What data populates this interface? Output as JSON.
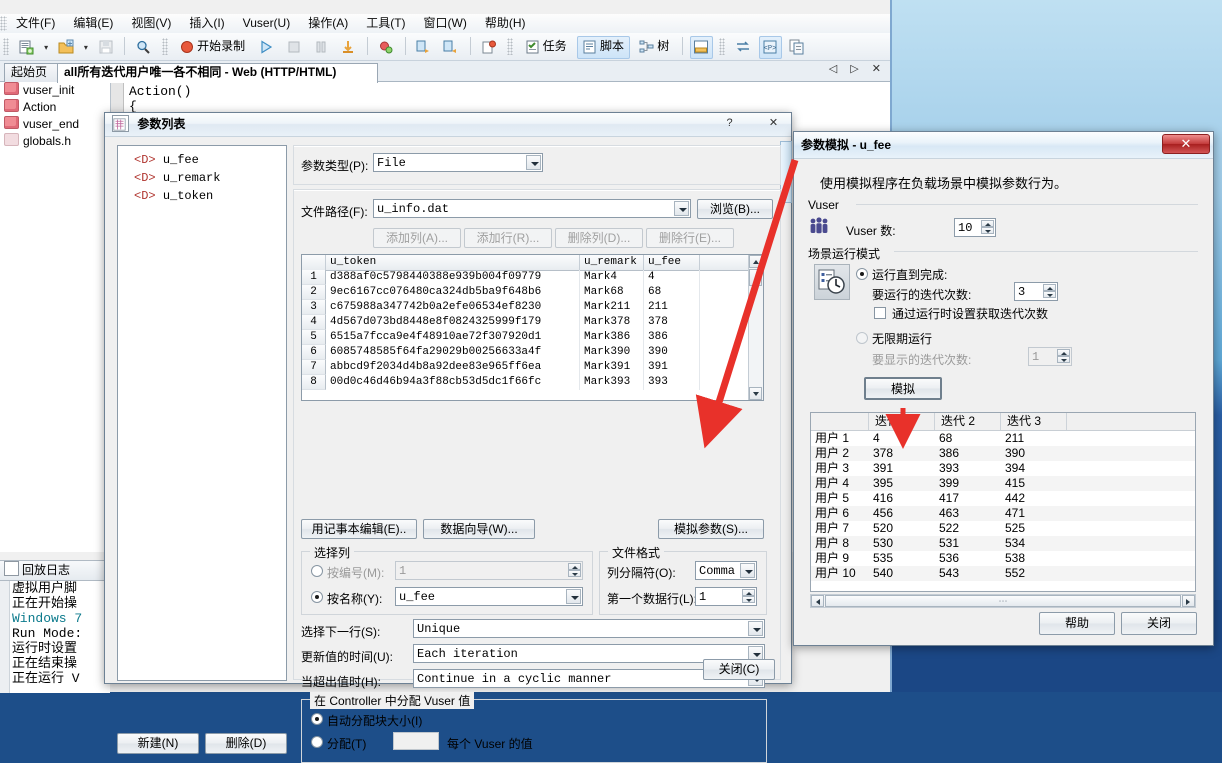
{
  "app": {
    "menubar": [
      "文件(F)",
      "编辑(E)",
      "视图(V)",
      "插入(I)",
      "Vuser(U)",
      "操作(A)",
      "工具(T)",
      "窗口(W)",
      "帮助(H)"
    ],
    "toolbar": {
      "record_label": "开始录制",
      "task_label": "任务",
      "script_label": "脚本",
      "tree_label": "树"
    },
    "tabs": [
      {
        "label": "起始页",
        "active": false
      },
      {
        "label": "all所有迭代用户唯一各不相同 - Web (HTTP/HTML)",
        "active": true
      }
    ],
    "tree_items": [
      {
        "label": "vuser_init",
        "icon": "action-icon"
      },
      {
        "label": "Action",
        "icon": "action-icon"
      },
      {
        "label": "vuser_end",
        "icon": "action-icon"
      },
      {
        "label": "globals.h",
        "icon": "header-icon"
      }
    ],
    "code_lines": [
      "Action()",
      "{"
    ],
    "log": {
      "tab_label": "回放日志",
      "lines": [
        "虚拟用户脚",
        "正在开始操",
        "Windows 7",
        "Run Mode:",
        "运行时设置",
        "正在结束操",
        "正在运行 V"
      ]
    }
  },
  "param_dialog": {
    "title": "参数列表",
    "help_btn": "?",
    "close_btn": "✕",
    "tree": [
      "u_fee",
      "u_remark",
      "u_token"
    ],
    "type_label": "参数类型(P):",
    "type_value": "File",
    "filepath_label": "文件路径(F):",
    "filepath_value": "u_info.dat",
    "browse_btn": "浏览(B)...",
    "row_buttons": [
      "添加列(A)...",
      "添加行(R)...",
      "删除列(D)...",
      "删除行(E)..."
    ],
    "table": {
      "columns": [
        "u_token",
        "u_remark",
        "u_fee"
      ],
      "rows": [
        {
          "n": "1",
          "u_token": "d388af0c5798440388e939b004f09779",
          "u_remark": "Mark4",
          "u_fee": "4"
        },
        {
          "n": "2",
          "u_token": "9ec6167cc076480ca324db5ba9f648b6",
          "u_remark": "Mark68",
          "u_fee": "68"
        },
        {
          "n": "3",
          "u_token": "c675988a347742b0a2efe06534ef8230",
          "u_remark": "Mark211",
          "u_fee": "211"
        },
        {
          "n": "4",
          "u_token": "4d567d073bd8448e8f0824325999f179",
          "u_remark": "Mark378",
          "u_fee": "378"
        },
        {
          "n": "5",
          "u_token": "6515a7fcca9e4f48910ae72f307920d1",
          "u_remark": "Mark386",
          "u_fee": "386"
        },
        {
          "n": "6",
          "u_token": "6085748585f64fa29029b00256633a4f",
          "u_remark": "Mark390",
          "u_fee": "390"
        },
        {
          "n": "7",
          "u_token": "abbcd9f2034d4b8a92dee83e965ff6ea",
          "u_remark": "Mark391",
          "u_fee": "391"
        },
        {
          "n": "8",
          "u_token": "00d0c46d46b94a3f88cb53d5dc1f66fc",
          "u_remark": "Mark393",
          "u_fee": "393"
        }
      ]
    },
    "notepad_btn": "用记事本编辑(E)..",
    "wizard_btn": "数据向导(W)...",
    "simulate_param_btn": "模拟参数(S)...",
    "select_col_group": "选择列",
    "by_number_label": "按编号(M):",
    "by_number_value": "1",
    "by_name_label": "按名称(Y):",
    "by_name_value": "u_fee",
    "file_format_group": "文件格式",
    "col_sep_label": "列分隔符(O):",
    "col_sep_value": "Comma",
    "first_row_label": "第一个数据行(L):",
    "first_row_value": "1",
    "next_row_label": "选择下一行(S):",
    "next_row_value": "Unique",
    "update_label": "更新值的时间(U):",
    "update_value": "Each iteration",
    "outofvalues_label": "当超出值时(H):",
    "outofvalues_value": "Continue in a cyclic manner",
    "alloc_group": "在 Controller 中分配 Vuser 值",
    "alloc_auto_label": "自动分配块大小(I)",
    "alloc_manual_label": "分配(T)",
    "alloc_manual_suffix": "每个 Vuser 的值",
    "alloc_manual_value": "",
    "new_btn": "新建(N)",
    "delete_btn": "删除(D)",
    "close_bottom_btn": "关闭(C)"
  },
  "sim_dialog": {
    "title": "参数模拟 - u_fee",
    "close_btn": "✕",
    "description": "使用模拟程序在负载场景中模拟参数行为。",
    "vuser_group": "Vuser",
    "vuser_count_label": "Vuser 数:",
    "vuser_count_value": "10",
    "runmode_group": "场景运行模式",
    "run_until_complete_label": "运行直到完成:",
    "iterations_label": "要运行的迭代次数:",
    "iterations_value": "3",
    "runtime_checkbox_label": "通过运行时设置获取迭代次数",
    "run_indefinitely_label": "无限期运行",
    "display_iterations_label": "要显示的迭代次数:",
    "display_iterations_value": "1",
    "simulate_btn": "模拟",
    "results": {
      "columns": [
        "",
        "迭代 1",
        "迭代 2",
        "迭代 3"
      ],
      "rows": [
        {
          "user": "用户 1",
          "v": [
            "4",
            "68",
            "211"
          ]
        },
        {
          "user": "用户 2",
          "v": [
            "378",
            "386",
            "390"
          ]
        },
        {
          "user": "用户 3",
          "v": [
            "391",
            "393",
            "394"
          ]
        },
        {
          "user": "用户 4",
          "v": [
            "395",
            "399",
            "415"
          ]
        },
        {
          "user": "用户 5",
          "v": [
            "416",
            "417",
            "442"
          ]
        },
        {
          "user": "用户 6",
          "v": [
            "456",
            "463",
            "471"
          ]
        },
        {
          "user": "用户 7",
          "v": [
            "520",
            "522",
            "525"
          ]
        },
        {
          "user": "用户 8",
          "v": [
            "530",
            "531",
            "534"
          ]
        },
        {
          "user": "用户 9",
          "v": [
            "535",
            "536",
            "538"
          ]
        },
        {
          "user": "用户 10",
          "v": [
            "540",
            "543",
            "552"
          ]
        }
      ]
    },
    "help_btn": "帮助",
    "close_bottom_btn": "关闭"
  },
  "colors": {
    "accent": "#c23a3a",
    "annotation_arrow": "#e8312a",
    "desktop": "#1b4785"
  }
}
